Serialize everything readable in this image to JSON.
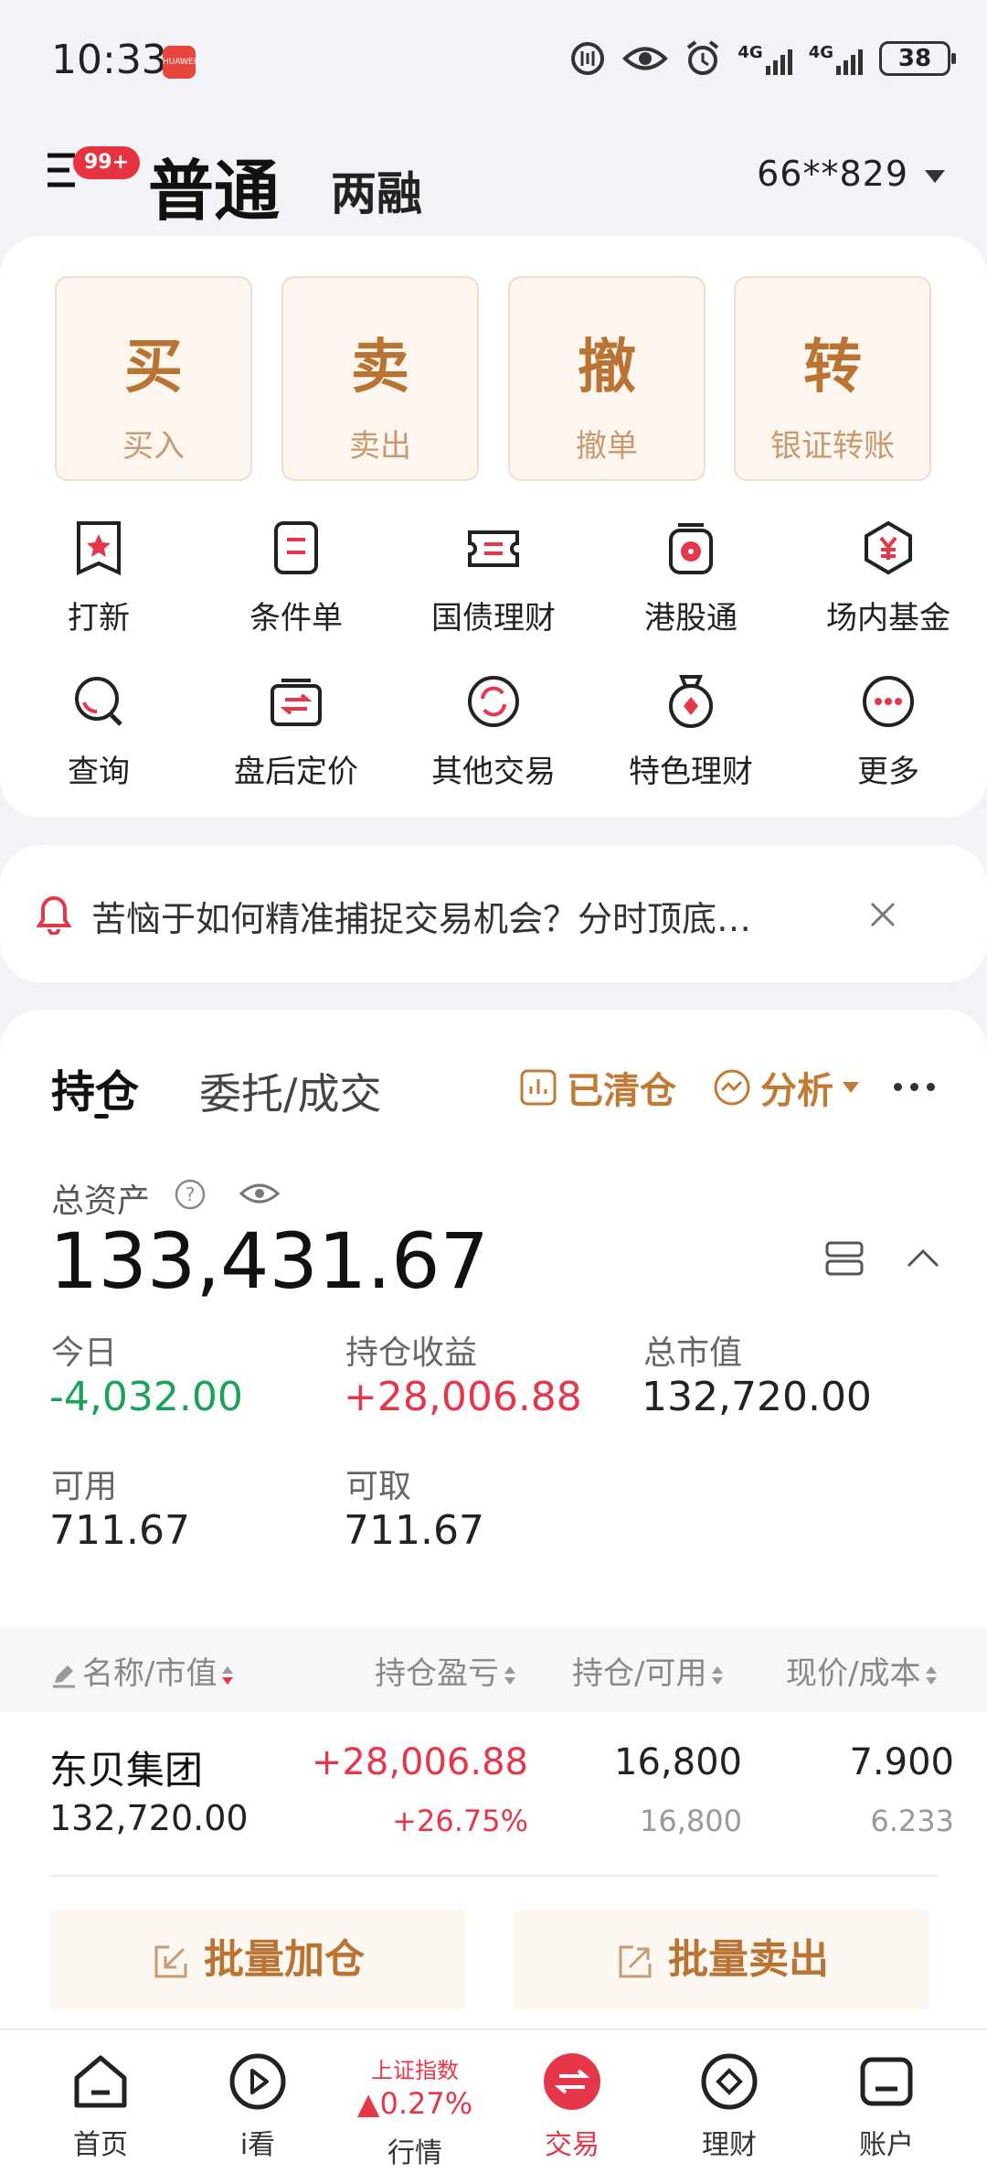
{
  "status_bar": {
    "time": "10:33",
    "battery": "38",
    "huawei_badge": "HUAWEI",
    "net1": "4G",
    "net2": "4G"
  },
  "header": {
    "menu_badge": "99+",
    "tab_normal": "普通",
    "tab_margin": "两融",
    "account": "66**829"
  },
  "actions": [
    {
      "main": "买",
      "sub": "买入"
    },
    {
      "main": "卖",
      "sub": "卖出"
    },
    {
      "main": "撤",
      "sub": "撤单"
    },
    {
      "main": "转",
      "sub": "银证转账"
    }
  ],
  "grid_row1": [
    {
      "label": "打新",
      "icon": "star-badge-icon"
    },
    {
      "label": "条件单",
      "icon": "condition-doc-icon"
    },
    {
      "label": "国债理财",
      "icon": "ticket-icon"
    },
    {
      "label": "港股通",
      "icon": "hk-flower-icon"
    },
    {
      "label": "场内基金",
      "icon": "yen-hexagon-icon"
    }
  ],
  "grid_row2": [
    {
      "label": "查询",
      "icon": "search-icon"
    },
    {
      "label": "盘后定价",
      "icon": "exchange-box-icon"
    },
    {
      "label": "其他交易",
      "icon": "refresh-circle-icon"
    },
    {
      "label": "特色理财",
      "icon": "medal-icon"
    },
    {
      "label": "更多",
      "icon": "more-dots-icon"
    }
  ],
  "notice": {
    "text": "苦恼于如何精准捕捉交易机会？分时顶底…"
  },
  "holdings": {
    "tab_hold": "持仓",
    "tab_order": "委托/成交",
    "cleared": "已清仓",
    "analysis": "分析",
    "total_label": "总资产",
    "total_value": "133,431.67",
    "today_label": "今日",
    "today_value": "-4,032.00",
    "pnl_label": "持仓收益",
    "pnl_value": "+28,006.88",
    "market_label": "总市值",
    "market_value": "132,720.00",
    "available_label": "可用",
    "available_value": "711.67",
    "withdraw_label": "可取",
    "withdraw_value": "711.67"
  },
  "table": {
    "headers": [
      "名称/市值",
      "持仓盈亏",
      "持仓/可用",
      "现价/成本"
    ],
    "rows": [
      {
        "name": "东贝集团",
        "market_value": "132,720.00",
        "pnl": "+28,006.88",
        "pnl_pct": "+26.75%",
        "position": "16,800",
        "available": "16,800",
        "price": "7.900",
        "cost": "6.233"
      }
    ]
  },
  "batch": {
    "add": "批量加仓",
    "sell": "批量卖出"
  },
  "bottom_nav": {
    "home": "首页",
    "watch": "i看",
    "index_name": "上证指数",
    "index_change": "0.27%",
    "market": "行情",
    "trade": "交易",
    "finance": "理财",
    "account": "账户"
  },
  "colors": {
    "accent": "#b97332",
    "red": "#e6364a",
    "green": "#1aa25a"
  }
}
